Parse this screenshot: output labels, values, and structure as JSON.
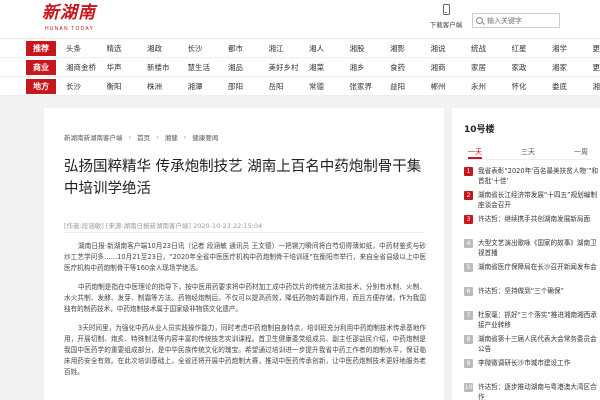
{
  "header": {
    "logo_text": "新湖南",
    "logo_sub": "HUNAN TODAY",
    "download_label": "下载客户端",
    "search_placeholder": "输入关键字"
  },
  "nav": {
    "rows": [
      {
        "category": "推荐",
        "items": [
          "头条",
          "精选",
          "湘政",
          "长沙",
          "都市",
          "湘江",
          "湘人",
          "湘股",
          "湘影",
          "湘说",
          "统战",
          "红星",
          "湘学",
          "更多"
        ]
      },
      {
        "category": "商业",
        "items": [
          "湘商金桥",
          "华声",
          "新楼市",
          "慧生活",
          "湘品",
          "美好乡村",
          "湘菜",
          "湘乡",
          "食药",
          "湘商",
          "家居",
          "家政",
          "湘家",
          "更多"
        ]
      },
      {
        "category": "地方",
        "items": [
          "长沙",
          "衡阳",
          "株洲",
          "湘潭",
          "邵阳",
          "岳阳",
          "常德",
          "张家界",
          "益阳",
          "郴州",
          "永州",
          "怀化",
          "娄底",
          "湘西"
        ]
      }
    ]
  },
  "article": {
    "breadcrumb": [
      "新湖南新湖南客户端",
      "首页",
      "湘健",
      "健康要闻"
    ],
    "title": "弘扬国粹精华 传承炮制技艺 湖南上百名中药炮制骨干集中培训学绝活",
    "meta": "[作者:段涵敏] [来源:湖南日报新湖南客户端] 2020-10-23 22:15:04",
    "paragraphs": [
      "湖南日报·新湖南客户端10月23日讯（记者 段涵敏 通讯员 王文德）一把铡刀瞬间将白芍切得薄如纸，中药材鉴炙与砂炒工艺学问多……10月21至23日，“2020年全省中医医疗机构中药炮制骨干培训班”在衡阳市举行，来自全省县级以上中医医疗机构中药炮制骨干等160余人现场学绝活。",
      "中药炮制是指在中医理论的指导下，按中医用药要求将中药材加工成中药饮片的传统方法和技术，分别有水制、火制、水火共制、发酵、发芽、制霜等方法。药物经炮制后，不仅可以提高药效，降低药物的毒副作用，而且方便存储。作为我国独有的制药技术，中药炮制技术属于国家级非物质文化遗产。",
      "3天时间里，为强化中药从业人员实践操作能力，同时考虑中药炮制自身特点，培训班充分利用中药炮制技术传承基地作用，开展切制、炮炙、特殊制法等内容丰富的传统技艺实训课程。首卫生健康委党组成员、副主任邵益民介绍，中药炮制是我国中医药学的重要组成部分，是中华民族传统文化的瑰宝。希望通过培训进一步提升我省中药工作者的炮制水平，保证临床用药安全有效。在此次培训基础上，全省还将开展中药炮制大赛，推动中医药传承创新，让中医药炮制技术更好地服务老百姓。"
    ]
  },
  "sidebar": {
    "title": "10号楼",
    "tabs": [
      "一天",
      "三天",
      "一周"
    ],
    "items": [
      {
        "rank": "1",
        "text": "我省表彰“2020年‘百名最美扶贫人物’”和首批‘十佳’"
      },
      {
        "rank": "2",
        "text": "湖南省长江经济带发展“十四五”规划编制座谈会召开"
      },
      {
        "rank": "3",
        "text": "许达哲：继续携手共创湖南发展新局面"
      },
      {
        "rank": "4",
        "text": "大型文艺演出歌咏《国家的故事》湖南卫视首播"
      },
      {
        "rank": "5",
        "text": "湖南省医疗保障局在长沙召开新闻发布会"
      },
      {
        "rank": "6",
        "text": "许达哲：坚持做到“三个确保”"
      },
      {
        "rank": "7",
        "text": "杜家毫：抓好“三个落实”推进湘南湘西承接产业转移"
      },
      {
        "rank": "8",
        "text": "湖南省第十三届人民代表大会常务委员会公告"
      },
      {
        "rank": "9",
        "text": "李微微调研长沙市城市建设工作"
      },
      {
        "rank": "10",
        "text": "许达哲：逐步推动湖南与粤港澳大湾区合作"
      }
    ]
  },
  "colors": {
    "brand": "#c8161d"
  }
}
